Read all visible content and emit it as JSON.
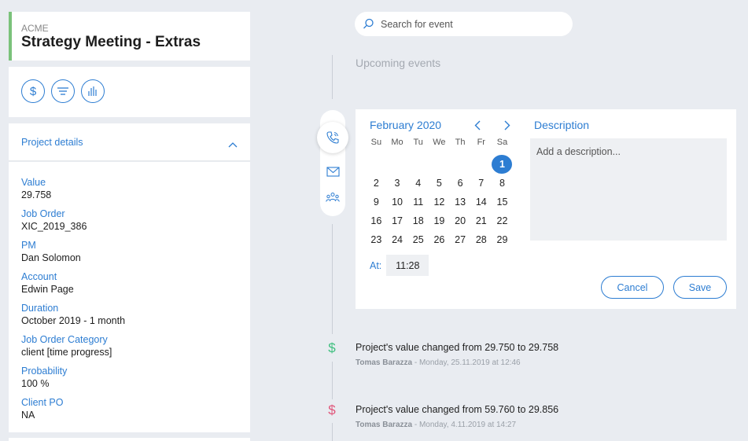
{
  "project": {
    "org": "ACME",
    "title": "Strategy Meeting - Extras"
  },
  "actions": [
    {
      "icon": "dollar-icon"
    },
    {
      "icon": "filter-icon"
    },
    {
      "icon": "bar-chart-icon"
    }
  ],
  "details": {
    "header": "Project details",
    "fields": [
      {
        "label": "Value",
        "value": "29.758"
      },
      {
        "label": "Job Order",
        "value": "XIC_2019_386"
      },
      {
        "label": "PM",
        "value": "Dan Solomon"
      },
      {
        "label": "Account",
        "value": "Edwin Page"
      },
      {
        "label": "Duration",
        "value": "October 2019 - 1 month"
      },
      {
        "label": "Job Order Category",
        "value": "client [time progress]"
      },
      {
        "label": "Probability",
        "value": "100 %"
      },
      {
        "label": "Client PO",
        "value": "NA"
      }
    ]
  },
  "search": {
    "placeholder": "Search for event"
  },
  "timeline": {
    "upcoming_label": "Upcoming events"
  },
  "event_types": [
    "phone-icon",
    "mail-icon",
    "meeting-icon"
  ],
  "calendar": {
    "month_label": "February 2020",
    "weekdays": [
      "Su",
      "Mo",
      "Tu",
      "We",
      "Th",
      "Fr",
      "Sa"
    ],
    "leading_blanks": 6,
    "days": [
      "1",
      "2",
      "3",
      "4",
      "5",
      "6",
      "7",
      "8",
      "9",
      "10",
      "11",
      "12",
      "13",
      "14",
      "15",
      "16",
      "17",
      "18",
      "19",
      "20",
      "21",
      "22",
      "23",
      "24",
      "25",
      "26",
      "27",
      "28",
      "29"
    ],
    "selected_day": "1",
    "at_label": "At:",
    "time": "11:28"
  },
  "description": {
    "title": "Description",
    "placeholder": "Add a description..."
  },
  "buttons": {
    "cancel": "Cancel",
    "save": "Save"
  },
  "events": [
    {
      "text": "Project's value changed from 29.750 to 29.758",
      "author": "Tomas Barazza",
      "date": " - Monday, 25.11.2019 at 12:46",
      "color": "#3fbf7f"
    },
    {
      "text": "Project's value changed from 59.760 to 29.856",
      "author": "Tomas Barazza",
      "date": " - Monday, 4.11.2019 at 14:27",
      "color": "#e0557a"
    }
  ],
  "colors": {
    "accent": "#2d7dd2",
    "header_bar": "#7ac27a"
  }
}
